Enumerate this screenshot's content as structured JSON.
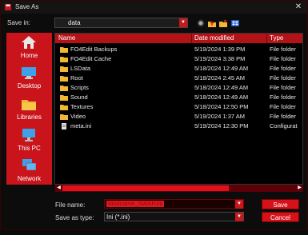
{
  "window": {
    "title": "Save As",
    "close_glyph": "✕"
  },
  "save_in": {
    "label": "Save in:",
    "value": "data",
    "arrow": "▼"
  },
  "places": [
    {
      "label": "Home",
      "icon": "home-icon"
    },
    {
      "label": "Desktop",
      "icon": "desktop-icon"
    },
    {
      "label": "Libraries",
      "icon": "libraries-icon"
    },
    {
      "label": "This PC",
      "icon": "this-pc-icon"
    },
    {
      "label": "Network",
      "icon": "network-icon"
    }
  ],
  "columns": {
    "name": "Name",
    "date": "Date modified",
    "type": "Type"
  },
  "files": [
    {
      "name": "FO4Edit Backups",
      "date": "5/19/2024 1:39 PM",
      "type": "File folder",
      "kind": "folder"
    },
    {
      "name": "FO4Edit Cache",
      "date": "5/19/2024 3:38 PM",
      "type": "File folder",
      "kind": "folder"
    },
    {
      "name": "LSData",
      "date": "5/18/2024 12:49 AM",
      "type": "File folder",
      "kind": "folder"
    },
    {
      "name": "Root",
      "date": "5/18/2024 2:45 AM",
      "type": "File folder",
      "kind": "folder"
    },
    {
      "name": "Scripts",
      "date": "5/18/2024 12:49 AM",
      "type": "File folder",
      "kind": "folder"
    },
    {
      "name": "Sound",
      "date": "5/18/2024 12:49 AM",
      "type": "File folder",
      "kind": "folder"
    },
    {
      "name": "Textures",
      "date": "5/18/2024 12:50 PM",
      "type": "File folder",
      "kind": "folder"
    },
    {
      "name": "Video",
      "date": "5/19/2024 1:37 AM",
      "type": "File folder",
      "kind": "folder"
    },
    {
      "name": "meta.ini",
      "date": "5/19/2024 12:30 PM",
      "type": "Configurat",
      "kind": "file"
    }
  ],
  "file_name": {
    "label": "File name:",
    "value": "Modname_SWAP.ini"
  },
  "save_as_type": {
    "label": "Save as type:",
    "value": "Ini (*.ini)"
  },
  "buttons": {
    "save": "Save",
    "cancel": "Cancel"
  },
  "scroll": {
    "left": "◀",
    "right": "▶"
  },
  "colors": {
    "accent": "#d5121a",
    "background": "#0a0a0a",
    "folder": "#f2b833"
  }
}
